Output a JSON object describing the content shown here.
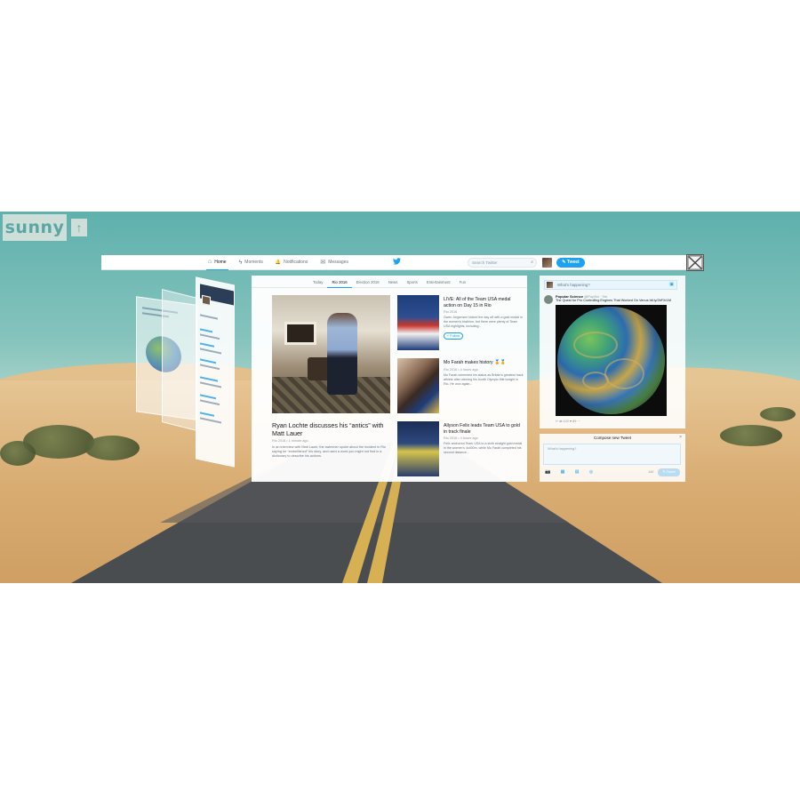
{
  "app": {
    "logo": "sunny",
    "up_button": "↑",
    "close_button": "close"
  },
  "nav": {
    "items": [
      {
        "label": "Home",
        "icon": "home-icon",
        "glyph": "⌂",
        "active": true
      },
      {
        "label": "Moments",
        "icon": "lightning-icon",
        "glyph": "ϟ",
        "active": false
      },
      {
        "label": "Notifications",
        "icon": "bell-icon",
        "glyph": "🔔",
        "active": false
      },
      {
        "label": "Messages",
        "icon": "envelope-icon",
        "glyph": "✉",
        "active": false
      }
    ],
    "search_placeholder": "Search Twitter",
    "tweet_button": "Tweet",
    "accent": "#1da1f2"
  },
  "tabs": [
    "Today",
    "Rio 2016",
    "Election 2016",
    "News",
    "Sports",
    "Entertainment",
    "Fun"
  ],
  "active_tab": "Rio 2016",
  "hero": {
    "title": "Ryan Lochte discusses his “antics” with Matt Lauer",
    "meta": "Rio 2016 • 1 minute ago",
    "desc": "In an interview with Matt Lauer, the swimmer spoke about the incident in Rio saying he “embellished” his story, and used a word you might not find in a dictionary to describe his actions."
  },
  "stories": [
    {
      "title": "LIVE: All of the Team USA medal action on Day 15 in Rio",
      "meta": "Rio 2016",
      "desc": "Gwen Jorgensen kicked the day off with a gold medal in the women's triathlon, but there were plenty of Team USA highlights, including...",
      "follow": "Follow"
    },
    {
      "title": "Mo Farah makes history 🏅🏅",
      "meta": "Rio 2016 • 4 hours ago",
      "desc": "Mo Farah cemented his status as Britain's greatest track athlete after winning his fourth Olympic title tonight in Rio. He won again..."
    },
    {
      "title": "Allyson Felix leads Team USA to gold in track finale",
      "meta": "Rio 2016 • 4 hours ago",
      "desc": "Felix anchored Team USA to a sixth straight gold medal in the women's 4x400m, while Mo Farah completed his second distance..."
    }
  ],
  "timeline": {
    "whats_happening": "What's happening?",
    "tweet_author": "Popular Science",
    "tweet_handle": "@PopSci · 9m",
    "tweet_text": "The Quest for Pro Controlling Engines That Worked On Venus bit.ly/2bFXr1M",
    "actions": "↩  ⇄ 102  ♥ 89  ···"
  },
  "compose": {
    "title": "Compose new Tweet",
    "placeholder": "What's happening?",
    "count": "140",
    "tweet_button": "Tweet",
    "icons": "📷 ▦ ▤ ◎"
  }
}
